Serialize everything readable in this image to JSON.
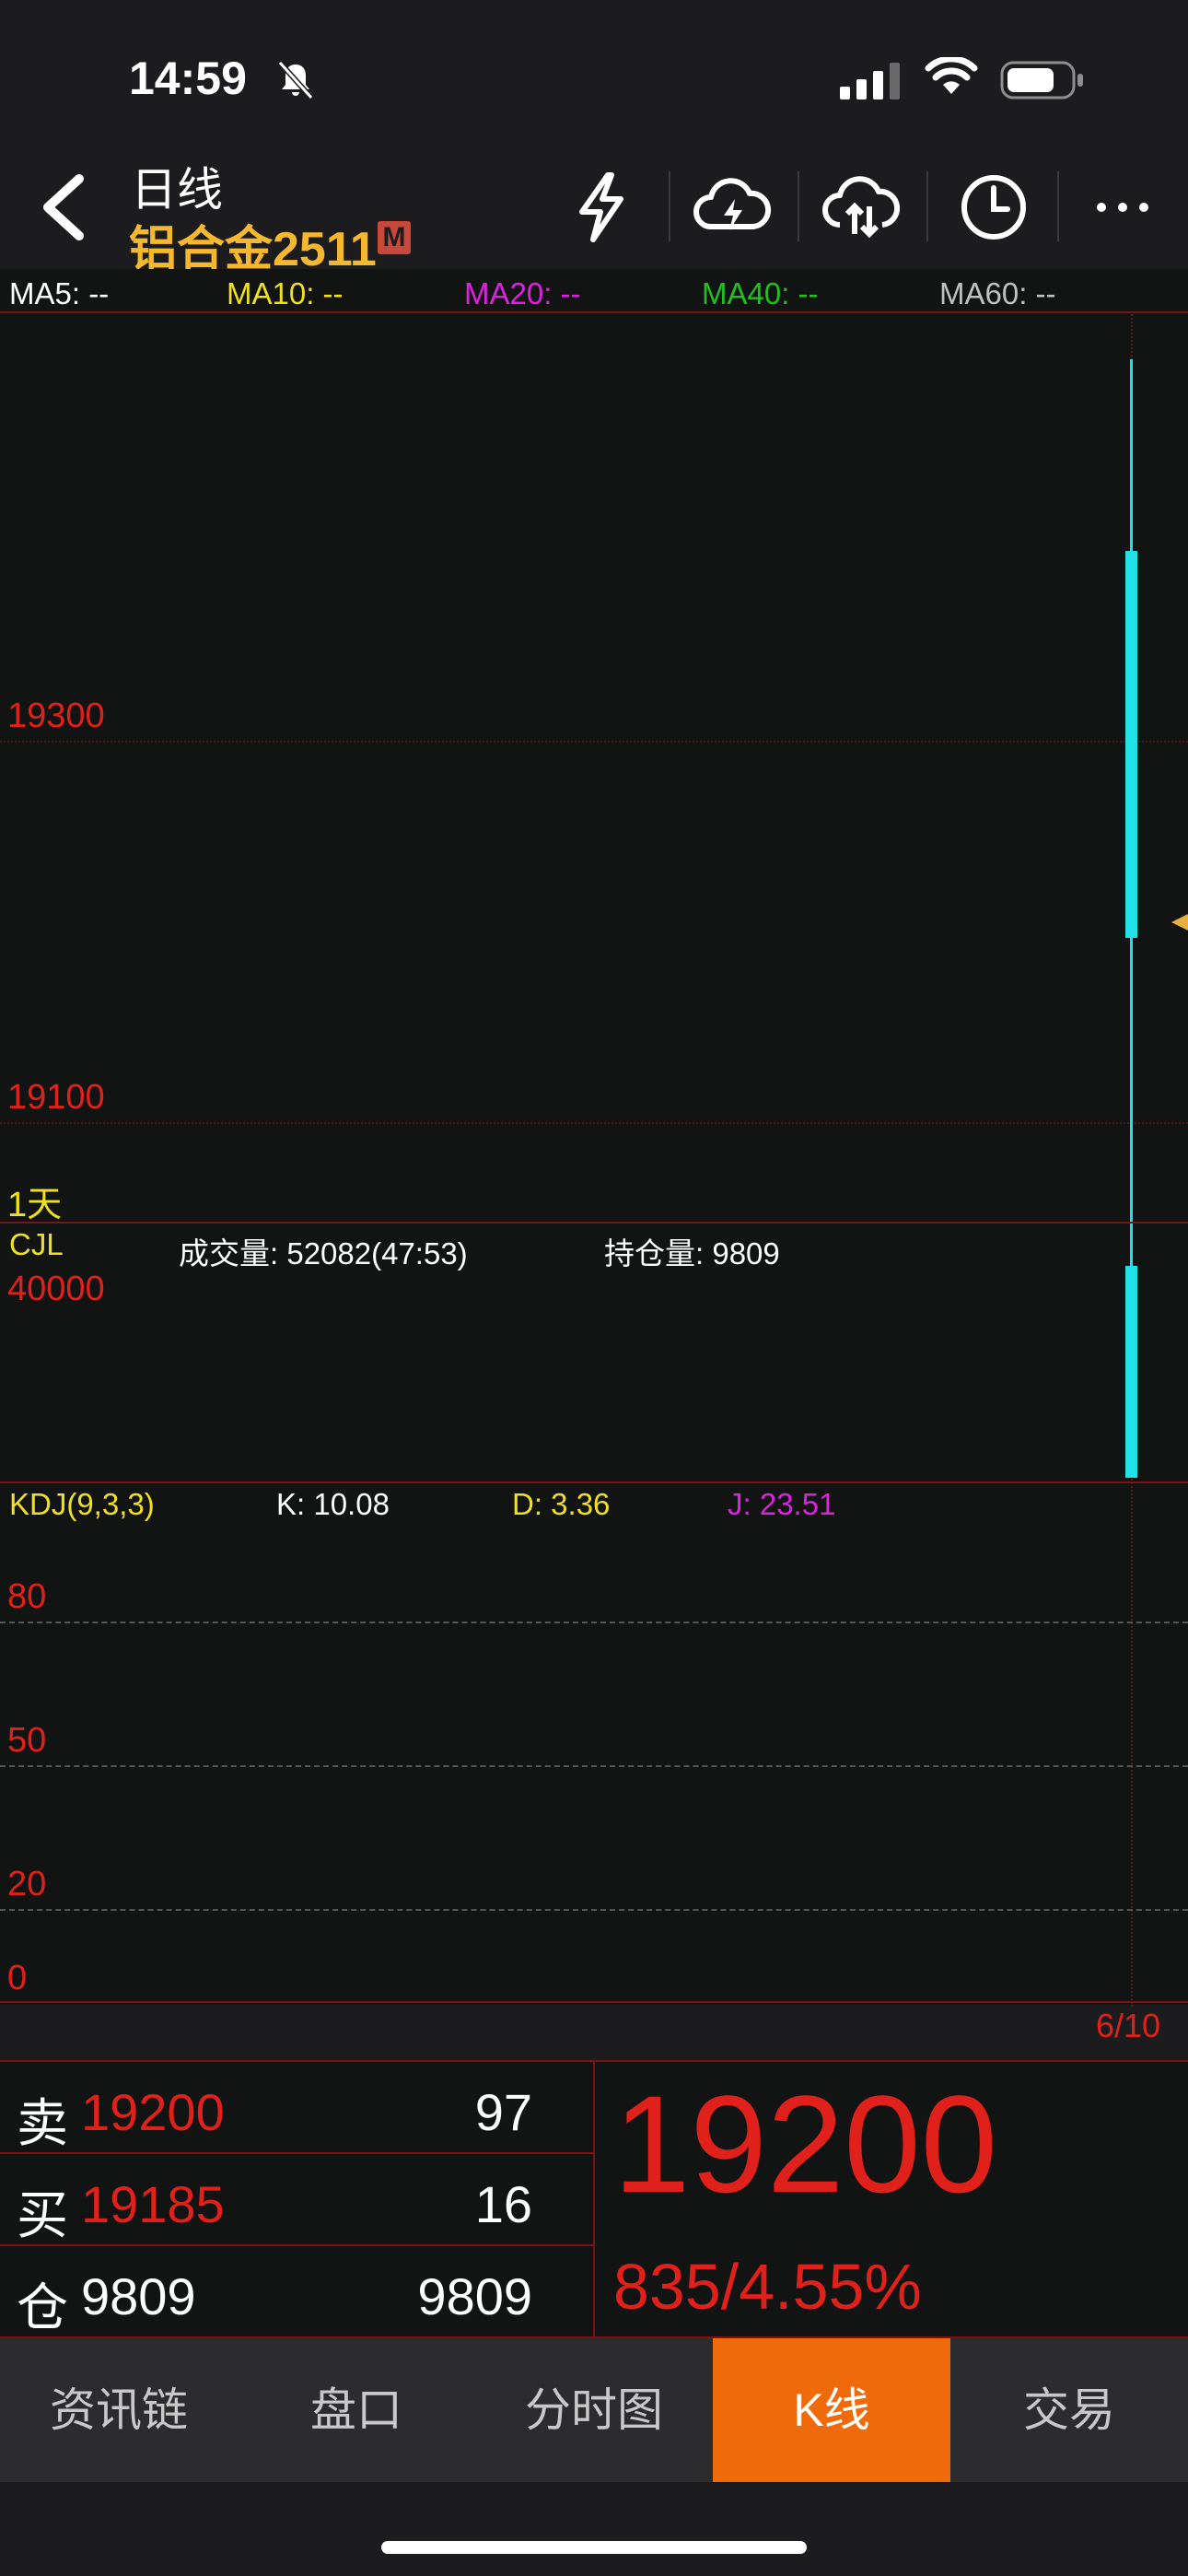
{
  "status_bar": {
    "time": "14:59"
  },
  "header": {
    "title": "日线",
    "subtitle": "铝合金2511",
    "badge": "M"
  },
  "ma_legend": {
    "ma5": "MA5: --",
    "ma10": "MA10: --",
    "ma20": "MA20: --",
    "ma40": "MA40: --",
    "ma60": "MA60: --"
  },
  "price_axis": {
    "upper": "19300",
    "lower": "19100"
  },
  "period_label": "1天",
  "volume_panel": {
    "label": "CJL",
    "volume": "成交量: 52082(47:53)",
    "open_interest": "持仓量: 9809",
    "axis_top": "40000"
  },
  "kdj_panel": {
    "label": "KDJ(9,3,3)",
    "k": "K: 10.08",
    "d": "D: 3.36",
    "j": "J: 23.51",
    "levels": [
      "80",
      "50",
      "20",
      "0"
    ]
  },
  "date_label": "6/10",
  "quote": {
    "sell_label": "卖",
    "sell_price": "19200",
    "sell_qty": "97",
    "buy_label": "买",
    "buy_price": "19185",
    "buy_qty": "16",
    "pos_label": "仓",
    "pos_value": "9809",
    "pos_value2": "9809",
    "last_price": "19200",
    "change": "835/4.55%"
  },
  "tabs": [
    "资讯链",
    "盘口",
    "分时图",
    "K线",
    "交易"
  ],
  "active_tab": "K线",
  "colors": {
    "up_candle": "#20e0e8",
    "price_red": "#e0201a",
    "accent_orange": "#ee6a0a",
    "title_gold": "#f5b82e",
    "ma5": "#ffffff",
    "ma10": "#f0e020",
    "ma20": "#e020e0",
    "ma40": "#20c020",
    "ma60": "#c0c0c0"
  }
}
